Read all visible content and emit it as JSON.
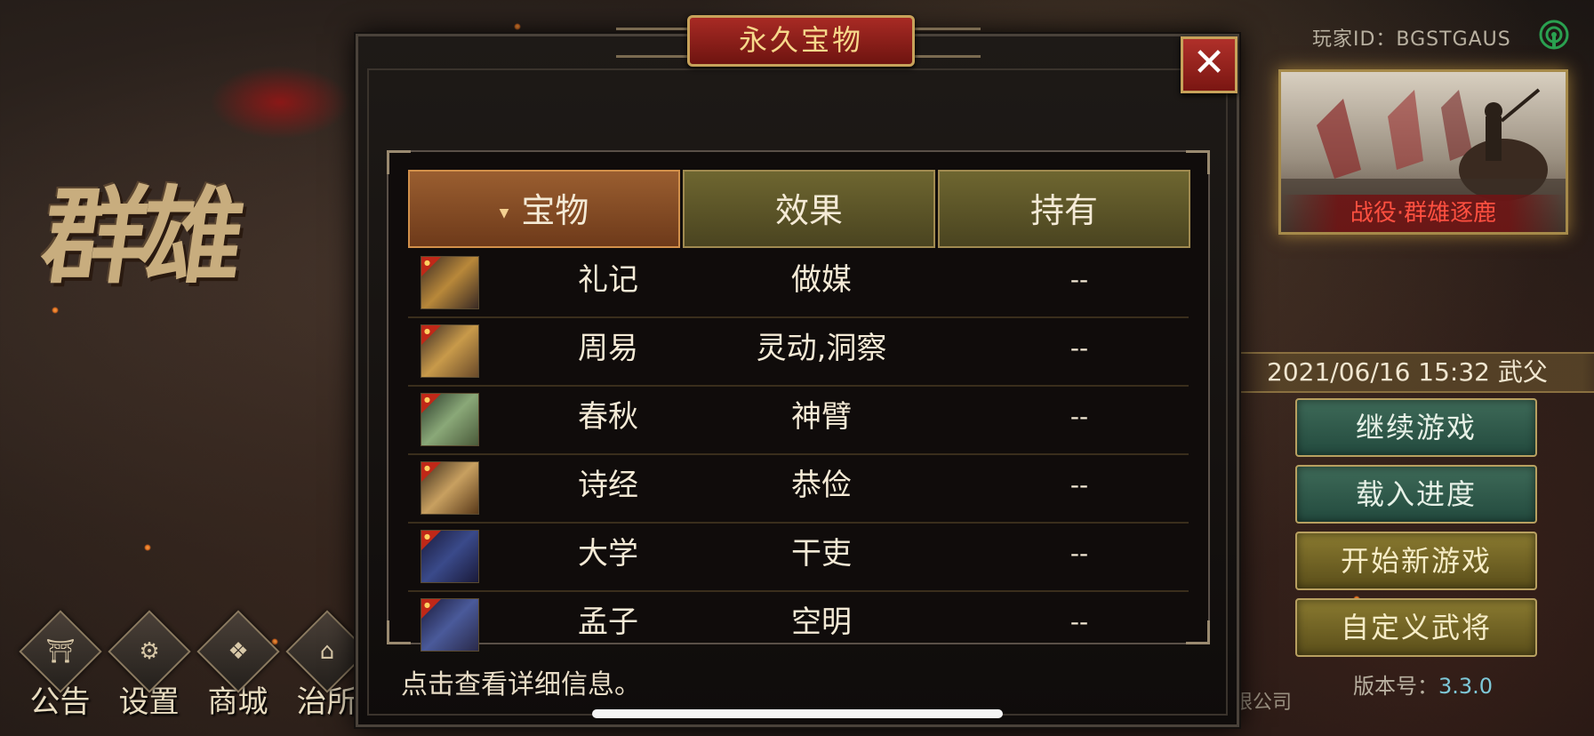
{
  "colors": {
    "title_plate": "#8e1e18",
    "header_active": "#8a5028",
    "header_plain": "#5e5828",
    "text_light": "#f4ead6",
    "accent_gold": "#c7a25a",
    "version_value": "#7ec8d8"
  },
  "background": {
    "logo_text": "群雄",
    "bottom_icons": [
      {
        "icon": "notice-icon",
        "label": "公告"
      },
      {
        "icon": "gear-icon",
        "label": "设置"
      },
      {
        "icon": "shop-icon",
        "label": "商城"
      },
      {
        "icon": "office-icon",
        "label": "治所"
      }
    ]
  },
  "right_panel": {
    "player_id": "玩家ID：BGSTGAUS",
    "campaign_caption": "战役·群雄逐鹿",
    "datetime": "2021/06/16 15:32 武父",
    "menu": [
      {
        "label": "继续游戏",
        "style": "green"
      },
      {
        "label": "载入进度",
        "style": "green"
      },
      {
        "label": "开始新游戏",
        "style": "gold"
      },
      {
        "label": "自定义武将",
        "style": "gold"
      }
    ],
    "version_label": "版本号：",
    "version_value": "3.3.0",
    "company_fragment": "有限公司"
  },
  "modal": {
    "title": "永久宝物",
    "close_glyph": "✕",
    "headers": {
      "treasure": "宝物",
      "effect": "效果",
      "held": "持有"
    },
    "sort_glyph": "▼",
    "items": [
      {
        "name": "礼记",
        "effect": "做媒",
        "held": "--",
        "icon": "scroll-icon",
        "icon_color": "#b8883a"
      },
      {
        "name": "周易",
        "effect": "灵动,洞察",
        "held": "--",
        "icon": "scroll-icon",
        "icon_color": "#c89a4a"
      },
      {
        "name": "春秋",
        "effect": "神臂",
        "held": "--",
        "icon": "scroll-icon",
        "icon_color": "#8aa878"
      },
      {
        "name": "诗经",
        "effect": "恭俭",
        "held": "--",
        "icon": "scroll-icon",
        "icon_color": "#c8a060"
      },
      {
        "name": "大学",
        "effect": "干吏",
        "held": "--",
        "icon": "bamboo-scroll-icon",
        "icon_color": "#3a4a8a"
      },
      {
        "name": "孟子",
        "effect": "空明",
        "held": "--",
        "icon": "scroll-icon",
        "icon_color": "#4a5a9a"
      }
    ],
    "hint": "点击查看详细信息。"
  }
}
